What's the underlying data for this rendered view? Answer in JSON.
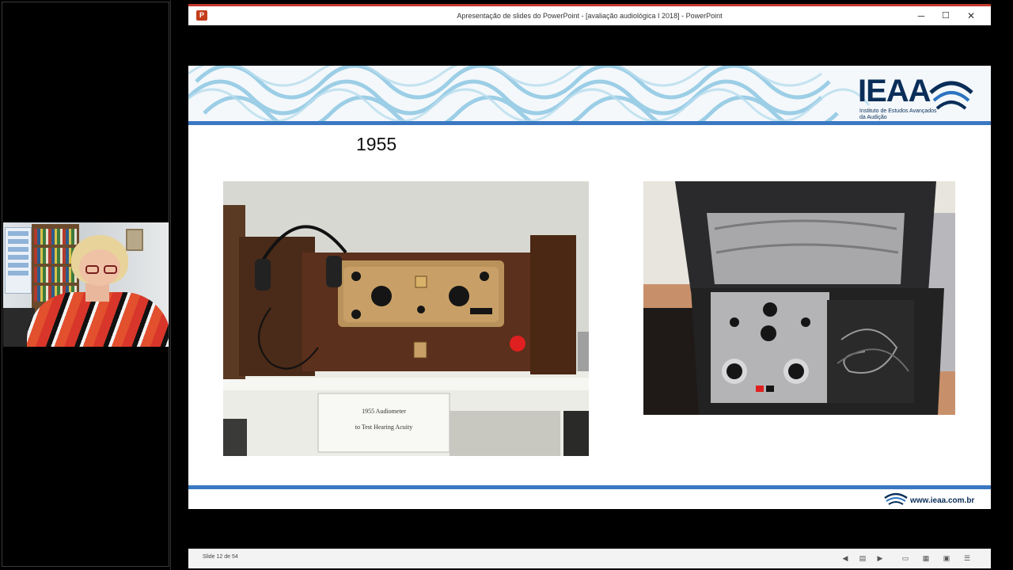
{
  "window": {
    "title": "Apresentação de slides do PowerPoint - [avaliação audiológica I 2018] - PowerPoint",
    "app_icon": "P",
    "minimize_glyph": "─",
    "maximize_glyph": "☐",
    "close_glyph": "✕"
  },
  "slide": {
    "year": "1955",
    "logo_text": "IEAA",
    "logo_subtitle": "Instituto de Estudos Avançados da Audição",
    "sign_line1": "1955 Audiometer",
    "sign_line2": "to Test Hearing Acuity",
    "footer_url": "www.ieaa.com.br"
  },
  "statusbar": {
    "slide_counter": "Slide 12 de 54"
  },
  "colors": {
    "accent_blue": "#3b78c2",
    "logo_navy": "#0b2e59",
    "window_border": "#c0392b"
  }
}
